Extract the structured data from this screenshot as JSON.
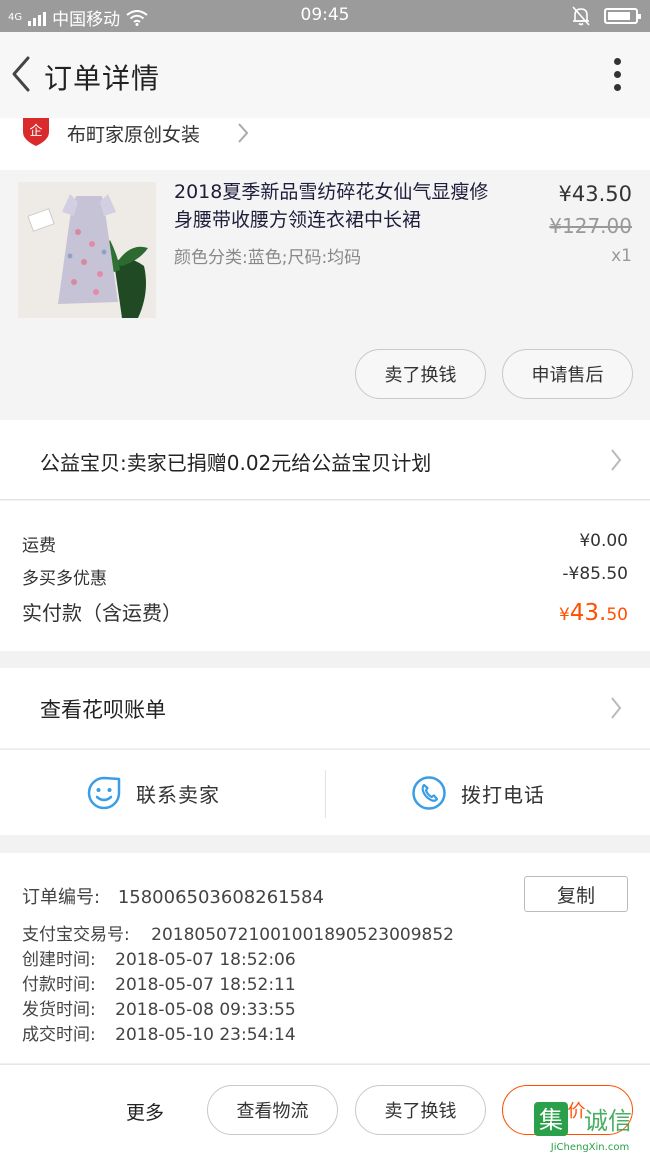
{
  "status_bar": {
    "network": "4G",
    "carrier": "中国移动",
    "time": "09:45",
    "battery_level": 0.85
  },
  "nav": {
    "title": "订单详情"
  },
  "shop": {
    "name": "布町家原创女装",
    "badge": "企"
  },
  "product": {
    "title_line1": "2018夏季新品雪纺碎花女仙气显瘦修",
    "title_line2": "身腰带收腰方领连衣裙中长裙",
    "spec": "颜色分类:蓝色;尺码:均码",
    "price": "¥43.50",
    "original_price": "¥127.00",
    "quantity": "x1",
    "actions": [
      "卖了换钱",
      "申请售后"
    ]
  },
  "charity": {
    "text": "公益宝贝:卖家已捐赠0.02元给公益宝贝计划"
  },
  "fees": {
    "shipping_label": "运费",
    "shipping_value": "¥0.00",
    "discount_label": "多买多优惠",
    "discount_value": "-¥85.50",
    "paid_label": "实付款（含运费）",
    "paid_currency": "¥",
    "paid_int": "43.",
    "paid_dec": "50",
    "accent_color": "#ff5000"
  },
  "bill": {
    "text": "查看花呗账单"
  },
  "contact": {
    "seller": "联系卖家",
    "phone": "拨打电话",
    "icon_color": "#3a9ee6"
  },
  "order_info": {
    "copy_label": "复制",
    "rows": [
      {
        "label": "订单编号:",
        "value": "158006503608261584"
      },
      {
        "label": "支付宝交易号:",
        "value": "2018050721001001890523009852"
      },
      {
        "label": "创建时间:",
        "value": "2018-05-07 18:52:06"
      },
      {
        "label": "付款时间:",
        "value": "2018-05-07 18:52:11"
      },
      {
        "label": "发货时间:",
        "value": "2018-05-08 09:33:55"
      },
      {
        "label": "成交时间:",
        "value": "2018-05-10 23:54:14"
      }
    ]
  },
  "bottom": {
    "more": "更多",
    "logistics": "查看物流",
    "sell": "卖了换钱",
    "review": "评价"
  },
  "watermark": {
    "brand": "集诚信",
    "mark": "集",
    "domain": "JiChengXin.com"
  }
}
